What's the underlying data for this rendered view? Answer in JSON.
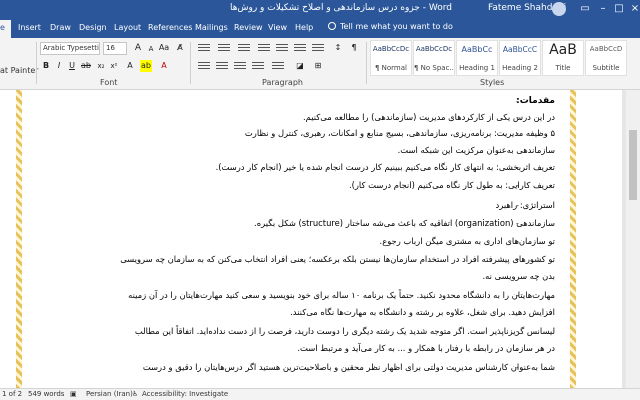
{
  "window": {
    "title": "جزوه درس سازماندهی و اصلاح تشکیلات و روش‌ها - Word",
    "user": "Fateme Shahdehi"
  },
  "tabs": {
    "file": "e",
    "items": [
      "Insert",
      "Draw",
      "Design",
      "Layout",
      "References",
      "Mailings",
      "Review",
      "View",
      "Help"
    ],
    "tell_me": "Tell me what you want to do"
  },
  "ribbon": {
    "format_painter": "at Painter",
    "font_name": "Arabic Typesettin",
    "font_size": "16",
    "groups": {
      "font": "Font",
      "paragraph": "Paragraph",
      "styles": "Styles"
    },
    "styles": [
      {
        "sample": "AaBbCcDc",
        "name": "¶ Normal"
      },
      {
        "sample": "AaBbCcDc",
        "name": "¶ No Spac..."
      },
      {
        "sample": "AaBbCc",
        "name": "Heading 1"
      },
      {
        "sample": "AaBbCcC",
        "name": "Heading 2"
      },
      {
        "sample": "AaB",
        "name": "Title"
      },
      {
        "sample": "AaBbCcD",
        "name": "Subtitle"
      }
    ]
  },
  "document": {
    "heading": "مقدمات:",
    "lines": [
      "در این درس یکی از کارکردهای مدیریت (سازماندهی) را مطالعه می‌کنیم.",
      "۵ وظیفه مدیریت: برنامه‌ریزی، سازماندهی، بسیج منابع و امکانات، رهبری، کنترل و نظارت",
      "سازماندهی به‌عنوان مرکزیت این شبکه است.",
      "تعریف اثربخشی: به انتهای کار نگاه می‌کنیم ببینیم کار درست انجام شده یا خیر (انجام کار درست).",
      "تعریف کارایی: به طول کار نگاه می‌کنیم (انجام درست کار).",
      "استراتژی: راهبرد",
      "سازماندهی (organization) اتفاقیه که باعث می‌شه ساختار (structure) شکل بگیره.",
      "تو سازمان‌های اداری به مشتری میگن ارباب رجوع.",
      "تو کشورهای پیشرفته افراد در استخدام سازمان‌ها نیستن بلکه برعکسه؛ یعنی افراد انتخاب می‌کنن که به سازمان چه سرویسی",
      "بدن چه سرویسی نه.",
      "مهارت‌هایتان را به دانشگاه محدود نکنید. حتماً یک برنامه ۱۰ ساله برای خود بنویسید و سعی کنید مهارت‌هایتان را در آن زمینه",
      "افزایش دهید. برای شغل، علاوه بر رشته و دانشگاه به مهارت‌ها نگاه می‌کنند.",
      "لیسانس گریزناپذیر است. اگر متوجه شدید یک رشته دیگری را دوست دارید، فرصت را از دست نداده‌اید. اتفاقاً این مطالب",
      "در هر سازمان در رابطه با رفتار با همکار و ... به کار می‌آید و مرتبط است.",
      "شما به‌عنوان کارشناس مدیریت دولتی برای اظهار نظر محقین و باصلاحیت‌ترین هستید اگر درس‌هایتان را دقیق و درست"
    ]
  },
  "status": {
    "page": "1 of 2",
    "words": "549 words",
    "language": "Persian (Iran)",
    "accessibility": "Accessibility: Investigate"
  }
}
